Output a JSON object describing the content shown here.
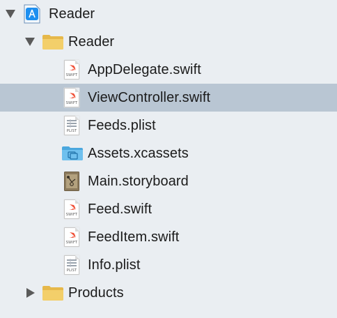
{
  "navigator": {
    "project": {
      "label": "Reader",
      "icon": "xcode-project-icon",
      "expanded": true
    },
    "group": {
      "label": "Reader",
      "icon": "folder-icon",
      "expanded": true
    },
    "files": [
      {
        "label": "AppDelegate.swift",
        "icon": "swift-file-icon",
        "tag": "SWIFT",
        "selected": false
      },
      {
        "label": "ViewController.swift",
        "icon": "swift-file-icon",
        "tag": "SWIFT",
        "selected": true
      },
      {
        "label": "Feeds.plist",
        "icon": "plist-file-icon",
        "tag": "PLIST",
        "selected": false
      },
      {
        "label": "Assets.xcassets",
        "icon": "asset-catalog-icon",
        "selected": false
      },
      {
        "label": "Main.storyboard",
        "icon": "storyboard-icon",
        "selected": false
      },
      {
        "label": "Feed.swift",
        "icon": "swift-file-icon",
        "tag": "SWIFT",
        "selected": false
      },
      {
        "label": "FeedItem.swift",
        "icon": "swift-file-icon",
        "tag": "SWIFT",
        "selected": false
      },
      {
        "label": "Info.plist",
        "icon": "plist-file-icon",
        "tag": "PLIST",
        "selected": false
      }
    ],
    "products": {
      "label": "Products",
      "icon": "folder-icon",
      "expanded": false
    }
  },
  "colors": {
    "background": "#eaeef2",
    "selection": "#b9c6d3",
    "folder": "#f3cf6a",
    "swift": "#f05138",
    "asset_folder": "#5fb8ea"
  }
}
